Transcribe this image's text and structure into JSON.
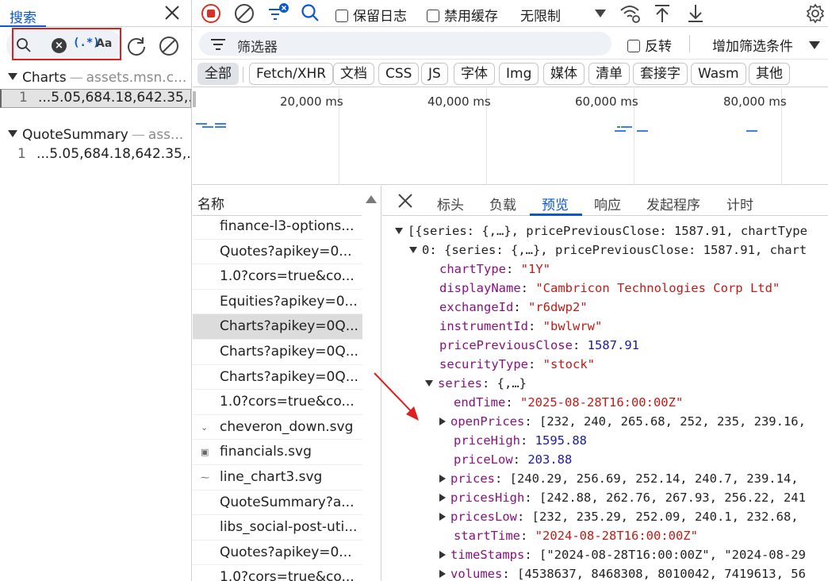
{
  "left_panel": {
    "tab_label": "搜索",
    "search": {
      "regex_label": "(.*)",
      "case_label": "Aa"
    },
    "results": [
      {
        "name": "Charts",
        "url": "assets.msn.c...",
        "line_no": "1",
        "line_text": "...5.05,684.18,642.35,..."
      },
      {
        "name": "QuoteSummary",
        "url": "ass...",
        "line_no": "1",
        "line_text": "...5.05,684.18,642.35,..."
      }
    ]
  },
  "toolbar": {
    "preserve_log": "保留日志",
    "disable_cache": "禁用缓存",
    "throttling": "无限制"
  },
  "filter": {
    "placeholder": "筛选器",
    "invert": "反转",
    "more_filters": "增加筛选条件"
  },
  "type_chips": [
    "全部",
    "Fetch/XHR",
    "文档",
    "CSS",
    "JS",
    "字体",
    "Img",
    "媒体",
    "清单",
    "套接字",
    "Wasm",
    "其他"
  ],
  "timeline": {
    "ticks": [
      "20,000 ms",
      "40,000 ms",
      "60,000 ms",
      "80,000 ms"
    ]
  },
  "request_list": {
    "header": "名称",
    "rows": [
      "finance-l3-options...",
      "Quotes?apikey=0...",
      "1.0?cors=true&co...",
      "Equities?apikey=0...",
      "Charts?apikey=0Q...",
      "Charts?apikey=0Q...",
      "Charts?apikey=0Q...",
      "1.0?cors=true&co...",
      "cheveron_down.svg",
      "financials.svg",
      "line_chart3.svg",
      "QuoteSummary?a...",
      "libs_social-post-uti...",
      "Quotes?apikey=0...",
      "1.0?cors=true&co..."
    ]
  },
  "detail": {
    "tabs": [
      "标头",
      "负载",
      "预览",
      "响应",
      "发起程序",
      "计时"
    ],
    "tree": {
      "root": "[{series: {,…}, pricePreviousClose: 1587.91, chartType",
      "item0": "0: {series: {,…}, pricePreviousClose: 1587.91, chart",
      "chartType_k": "chartType",
      "chartType_v": "\"1Y\"",
      "displayName_k": "displayName",
      "displayName_v": "\"Cambricon Technologies Corp Ltd\"",
      "exchangeId_k": "exchangeId",
      "exchangeId_v": "\"r6dwp2\"",
      "instrumentId_k": "instrumentId",
      "instrumentId_v": "\"bwlwrw\"",
      "pricePreviousClose_k": "pricePreviousClose",
      "pricePreviousClose_v": "1587.91",
      "securityType_k": "securityType",
      "securityType_v": "\"stock\"",
      "series_k": "series",
      "series_v": "{,…}",
      "endTime_k": "endTime",
      "endTime_v": "\"2025-08-28T16:00:00Z\"",
      "openPrices_k": "openPrices",
      "openPrices_v": "[232, 240, 265.68, 252, 235, 239.16,",
      "priceHigh_k": "priceHigh",
      "priceHigh_v": "1595.88",
      "priceLow_k": "priceLow",
      "priceLow_v": "203.88",
      "prices_k": "prices",
      "prices_v": "[240.29, 256.69, 252.14, 240.7, 239.14,",
      "pricesHigh_k": "pricesHigh",
      "pricesHigh_v": "[242.88, 262.76, 267.93, 256.22, 241",
      "pricesLow_k": "pricesLow",
      "pricesLow_v": "[232, 235.29, 252.09, 240.1, 232.68,",
      "startTime_k": "startTime",
      "startTime_v": "\"2024-08-28T16:00:00Z\"",
      "timeStamps_k": "timeStamps",
      "timeStamps_v": "[\"2024-08-28T16:00:00Z\", \"2024-08-29",
      "volumes_k": "volumes",
      "volumes_v": "[4538637, 8468308, 8010042, 7419613, 56"
    }
  },
  "colors": {
    "accent": "#0b57d0",
    "record_red": "#d93025",
    "highlight_red": "#e02020",
    "key": "#881280",
    "string": "#c41a16",
    "number": "#1a1aa6"
  }
}
